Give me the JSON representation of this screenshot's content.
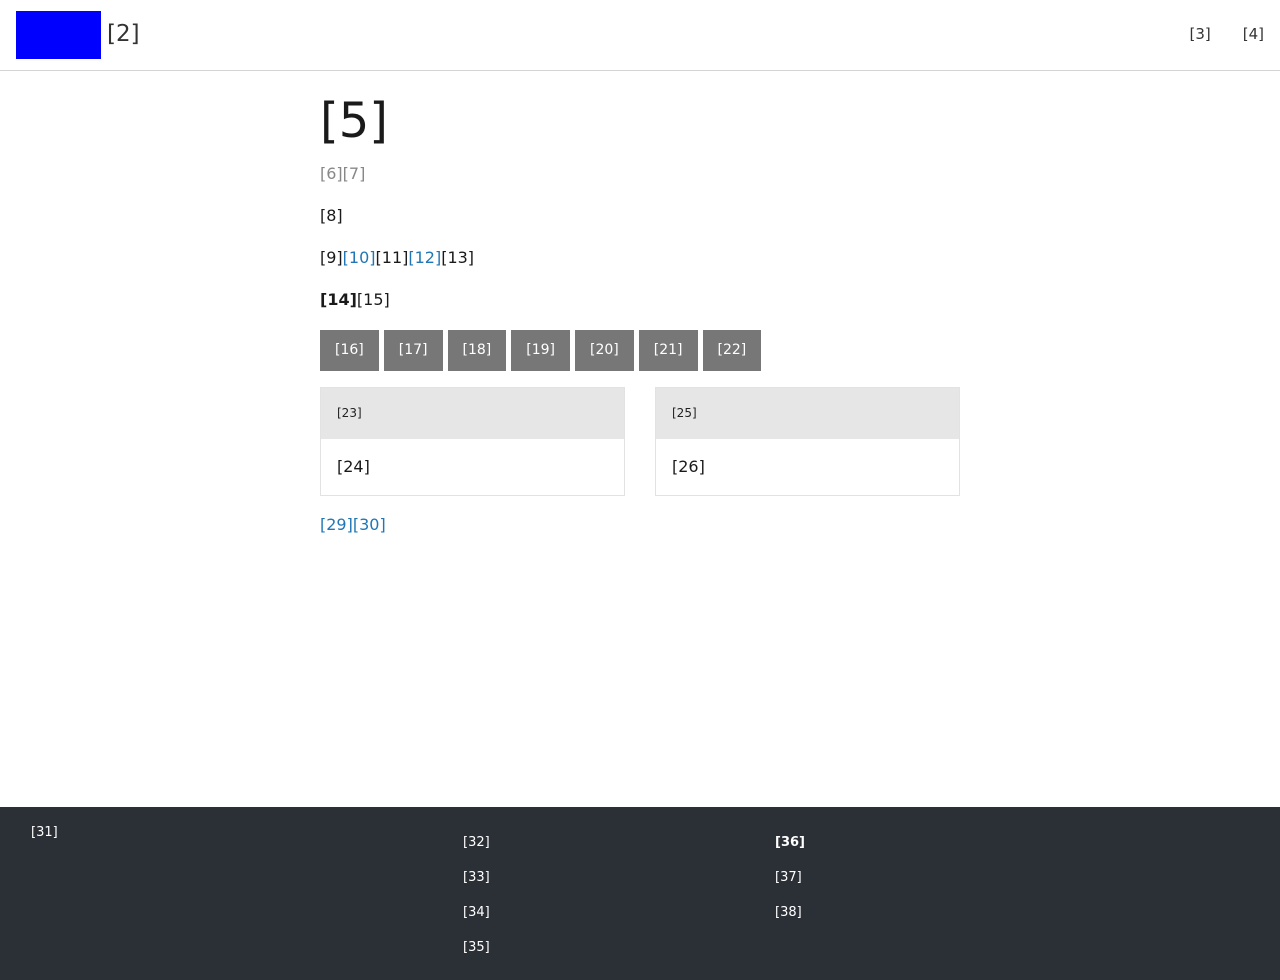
{
  "header": {
    "site_title": "[2]",
    "nav": [
      {
        "icon": "",
        "label": "[3]"
      },
      {
        "icon": "",
        "label": "[4]"
      }
    ]
  },
  "main": {
    "title": "[5]",
    "meta": {
      "a": "[6]",
      "b": "[7]"
    },
    "para1": "[8]",
    "para2": {
      "t1": "[9]",
      "l1": "[10]",
      "t2": "[11]",
      "l2": "[12]",
      "t3": "[13]"
    },
    "para3": {
      "bold": "[14]",
      "text": "[15]"
    },
    "buttons": [
      {
        "icon": "",
        "label": "[16]"
      },
      {
        "icon": "",
        "label": "[17]"
      },
      {
        "icon": "",
        "label": "[18]"
      },
      {
        "icon": "",
        "label": "[19]"
      },
      {
        "icon": "",
        "label": "[20]"
      },
      {
        "icon": "",
        "label": "[21]"
      },
      {
        "icon": "",
        "label": "[22]"
      }
    ],
    "cards": [
      {
        "head_icon": "",
        "head": "[23]",
        "body": "[24]"
      },
      {
        "head": "[25]",
        "head_icon": "",
        "body": "[26]"
      }
    ],
    "links": {
      "l1": "[29]",
      "l2": "[30]"
    }
  },
  "footer": {
    "brand": "[31]",
    "col1": [
      {
        "icon": "",
        "label": "[32]"
      },
      {
        "icon": "",
        "label": "[33]"
      },
      {
        "icon": "",
        "label": "[34]"
      },
      {
        "icon": "",
        "label": "[35]"
      }
    ],
    "col2_head": "[36]",
    "col2": [
      {
        "icon": "",
        "label": "[37]"
      },
      {
        "icon": "",
        "label": "[38]"
      }
    ],
    "social": [
      "",
      "",
      "",
      "",
      "",
      ""
    ]
  }
}
